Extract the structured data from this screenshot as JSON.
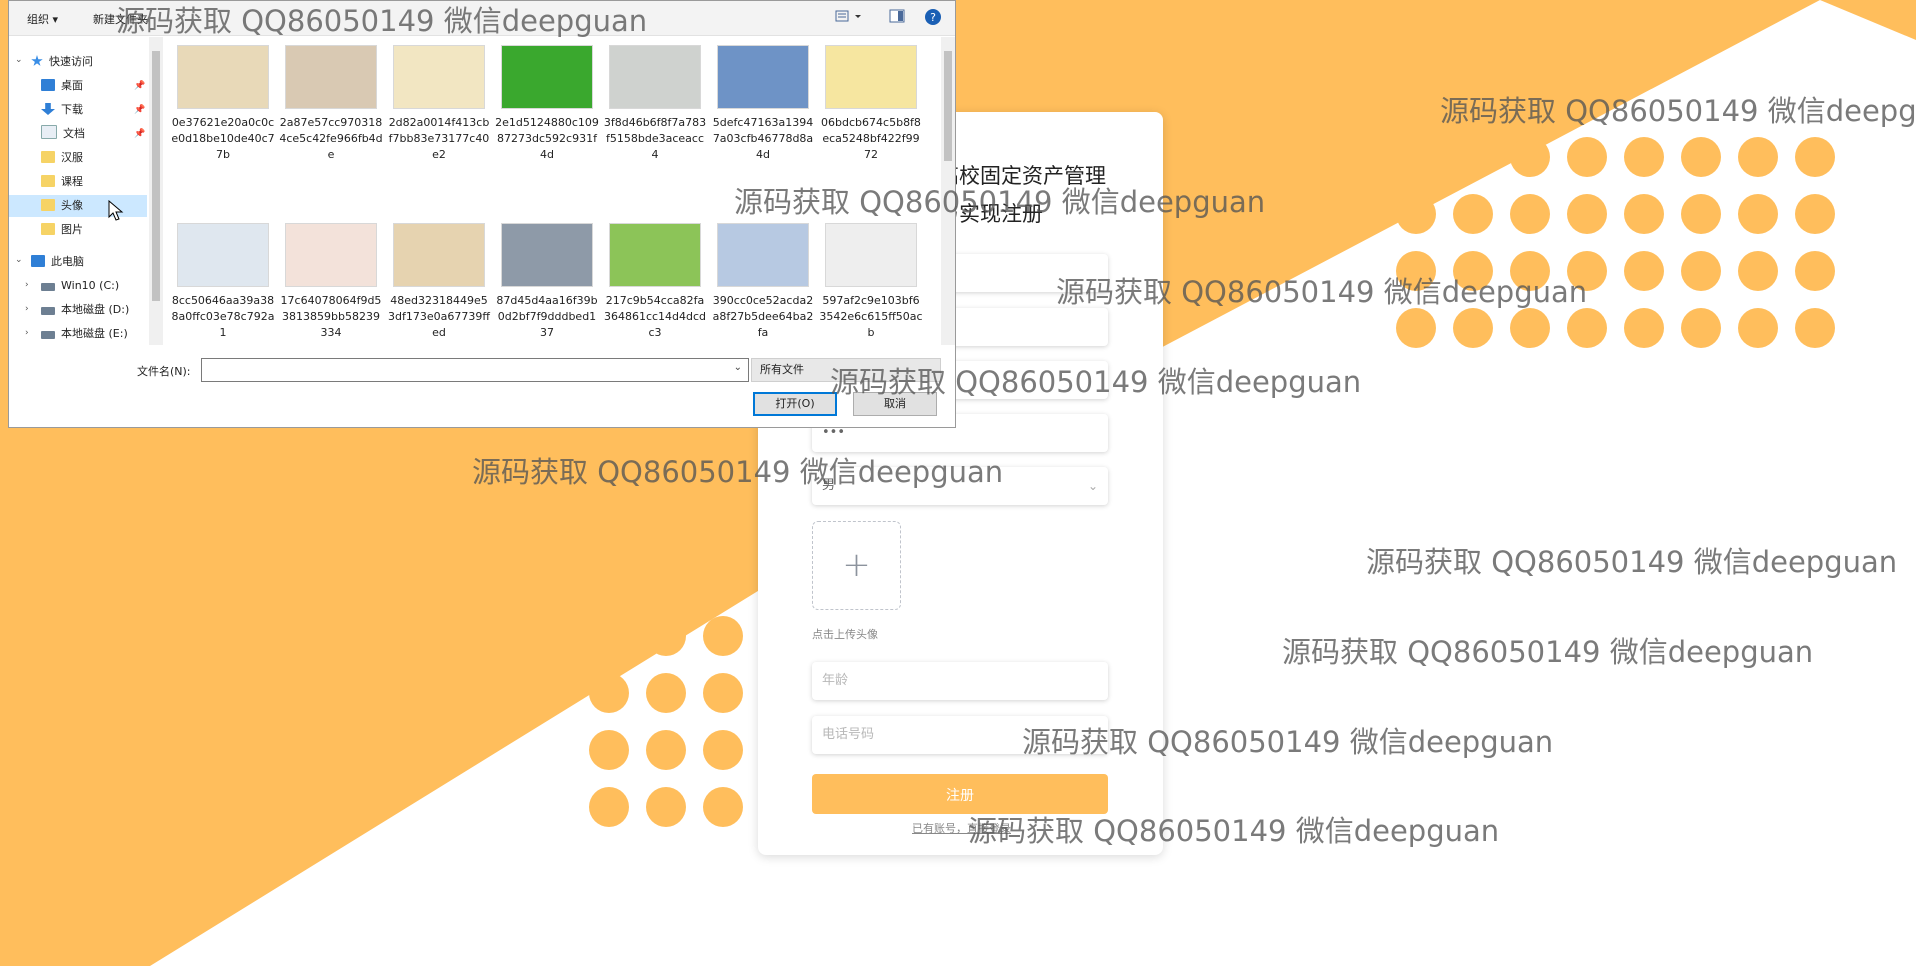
{
  "colors": {
    "accent": "#ffbe5c",
    "background": "#ffffff",
    "dialog_selection": "#cce8ff"
  },
  "dialog": {
    "toolbar": {
      "organize": "组织 ▾",
      "new_folder": "新建文件夹",
      "view_icon": "view-icon",
      "help_icon": "help-icon"
    },
    "nav": [
      {
        "label": "快速访问",
        "icon": "star-icon"
      },
      {
        "label": "桌面",
        "icon": "desktop-icon"
      },
      {
        "label": "下载",
        "icon": "download-icon"
      },
      {
        "label": "文档",
        "icon": "document-icon"
      },
      {
        "label": "汉服",
        "icon": "folder-icon"
      },
      {
        "label": "课程",
        "icon": "folder-icon"
      },
      {
        "label": "头像",
        "icon": "folder-icon"
      },
      {
        "label": "图片",
        "icon": "folder-icon"
      },
      {
        "label": "此电脑",
        "icon": "computer-icon"
      },
      {
        "label": "Win10 (C:)",
        "icon": "drive-icon"
      },
      {
        "label": "本地磁盘 (D:)",
        "icon": "drive-icon"
      },
      {
        "label": "本地磁盘 (E:)",
        "icon": "drive-icon"
      }
    ],
    "files": [
      {
        "name": "0e37621e20a0c0ce0d18be10de40c77b",
        "thumb": "#e8d9b8"
      },
      {
        "name": "2a87e57cc9703184ce5c42fe966fb4de",
        "thumb": "#d9c9b3"
      },
      {
        "name": "2d82a0014f413cbf7bb83e73177c40e2",
        "thumb": "#f2e6c2"
      },
      {
        "name": "2e1d5124880c10987273dc592c931f4d",
        "thumb": "#3aa82e"
      },
      {
        "name": "3f8d46b6f8f7a783f5158bde3aceacc4",
        "thumb": "#cfd2cf"
      },
      {
        "name": "5defc47163a13947a03cfb46778d8a4d",
        "thumb": "#6e93c6"
      },
      {
        "name": "06bdcb674c5b8f8eca5248bf422f9972",
        "thumb": "#f6e6a0"
      },
      {
        "name": "8cc50646aa39a388a0ffc03e78c792a1",
        "thumb": "#dfe7ef"
      },
      {
        "name": "17c64078064f9d53813859bb58239334",
        "thumb": "#f3e2da"
      },
      {
        "name": "48ed32318449e53df173e0a67739ffed",
        "thumb": "#e6d3b0"
      },
      {
        "name": "87d45d4aa16f39b0d2bf7f9dddbed137",
        "thumb": "#8e9aa8"
      },
      {
        "name": "217c9b54cca82fa364861cc14d4dcdc3",
        "thumb": "#8cc458"
      },
      {
        "name": "390cc0ce52acda2a8f27b5dee64ba2fa",
        "thumb": "#b7c9e2"
      },
      {
        "name": "597af2c9e103bf63542e6c615ff50acb",
        "thumb": "#eeeeee"
      }
    ],
    "filename_label": "文件名(N):",
    "filename_value": "",
    "filetype": "所有文件",
    "open_label": "打开(O)",
    "cancel_label": "取消"
  },
  "register": {
    "title_line1": "高校固定资产管理",
    "title_line2": "与实现注册",
    "password_value": "•••",
    "gender_value": "男",
    "upload_plus": "+",
    "upload_hint": "点击上传头像",
    "age_placeholder": "年龄",
    "phone_placeholder": "电话号码",
    "register_label": "注册",
    "login_link": "已有账号，直接登录"
  },
  "watermark": "源码获取 QQ86050149 微信deepguan"
}
